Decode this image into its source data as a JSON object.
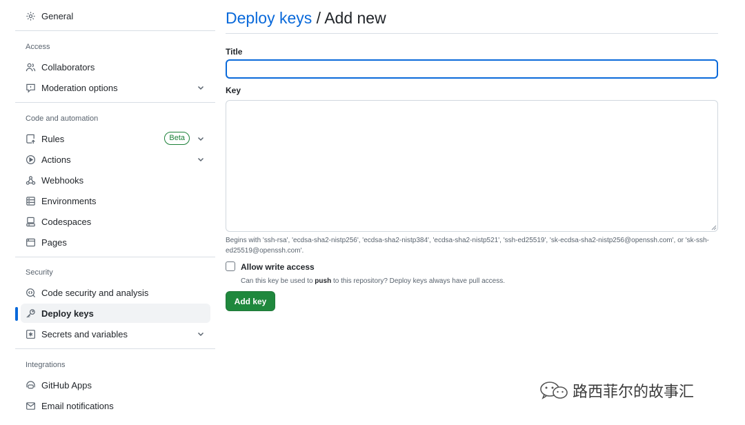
{
  "sidebar": {
    "general": "General",
    "sections": {
      "access": "Access",
      "code_automation": "Code and automation",
      "security": "Security",
      "integrations": "Integrations"
    },
    "items": {
      "collaborators": "Collaborators",
      "moderation": "Moderation options",
      "rules": "Rules",
      "rules_badge": "Beta",
      "actions": "Actions",
      "webhooks": "Webhooks",
      "environments": "Environments",
      "codespaces": "Codespaces",
      "pages": "Pages",
      "code_security": "Code security and analysis",
      "deploy_keys": "Deploy keys",
      "secrets": "Secrets and variables",
      "github_apps": "GitHub Apps",
      "email_notifications": "Email notifications"
    },
    "active_item": "deploy_keys"
  },
  "main": {
    "breadcrumb_link": "Deploy keys",
    "breadcrumb_sep": " / ",
    "breadcrumb_current": "Add new",
    "title_label": "Title",
    "title_value": "",
    "key_label": "Key",
    "key_value": "",
    "key_hint": "Begins with 'ssh-rsa', 'ecdsa-sha2-nistp256', 'ecdsa-sha2-nistp384', 'ecdsa-sha2-nistp521', 'ssh-ed25519', 'sk-ecdsa-sha2-nistp256@openssh.com', or 'sk-ssh-ed25519@openssh.com'.",
    "write_access_label": "Allow write access",
    "write_access_checked": false,
    "write_access_desc_pre": "Can this key be used to ",
    "write_access_desc_bold": "push",
    "write_access_desc_post": " to this repository? Deploy keys always have pull access.",
    "submit_label": "Add key"
  },
  "watermark": {
    "text": "路西菲尔的故事汇"
  },
  "colors": {
    "link": "#0969da",
    "primary_button": "#1f883d",
    "beta_badge": "#1a7f37",
    "active_indicator": "#0969da"
  },
  "icons": {
    "general": "gear-icon",
    "collaborators": "people-icon",
    "moderation": "report-icon",
    "rules": "repo-push-icon",
    "actions": "play-icon",
    "webhooks": "webhook-icon",
    "environments": "server-icon",
    "codespaces": "codespaces-icon",
    "pages": "browser-icon",
    "code_security": "codescan-icon",
    "deploy_keys": "key-icon",
    "secrets": "asterisk-icon",
    "github_apps": "apps-icon",
    "email_notifications": "mail-icon"
  }
}
